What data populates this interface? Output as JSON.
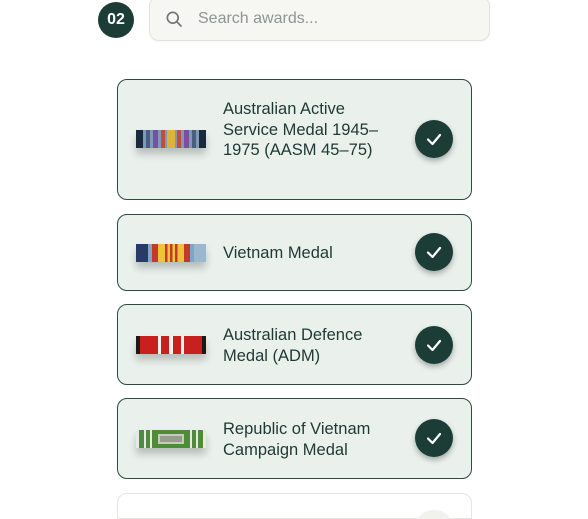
{
  "step": {
    "number": "02"
  },
  "search": {
    "placeholder": "Search awards..."
  },
  "awards": [
    {
      "name": "Australian Active Service Medal 1945–1975 (AASM 45–75)",
      "selected": true,
      "ribbon_icon": "aasm-ribbon"
    },
    {
      "name": "Vietnam Medal",
      "selected": true,
      "ribbon_icon": "vietnam-medal-ribbon"
    },
    {
      "name": "Australian Defence Medal (ADM)",
      "selected": true,
      "ribbon_icon": "adm-ribbon"
    },
    {
      "name": "Republic of Vietnam Campaign Medal",
      "selected": true,
      "ribbon_icon": "rvn-campaign-ribbon"
    }
  ],
  "colors": {
    "accent": "#1c3d36",
    "card_bg": "#eaf1ed",
    "card_border": "#2e4a43",
    "text": "#1f3833"
  }
}
